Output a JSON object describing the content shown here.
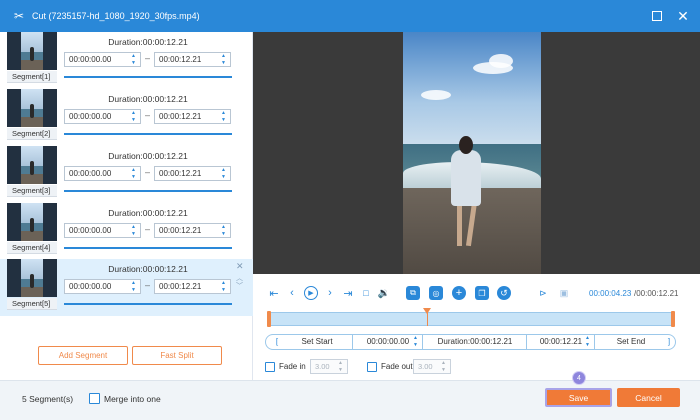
{
  "window": {
    "title": "Cut (7235157-hd_1080_1920_30fps.mp4)",
    "icons": {
      "app": "scissors-icon",
      "maximize": "maximize-icon",
      "close": "close-icon"
    }
  },
  "segments": [
    {
      "label": "Segment[1]",
      "duration": "Duration:00:00:12.21",
      "start": "00:00:00.00",
      "end": "00:00:12.21",
      "active": false
    },
    {
      "label": "Segment[2]",
      "duration": "Duration:00:00:12.21",
      "start": "00:00:00.00",
      "end": "00:00:12.21",
      "active": false
    },
    {
      "label": "Segment[3]",
      "duration": "Duration:00:00:12.21",
      "start": "00:00:00.00",
      "end": "00:00:12.21",
      "active": false
    },
    {
      "label": "Segment[4]",
      "duration": "Duration:00:00:12.21",
      "start": "00:00:00.00",
      "end": "00:00:12.21",
      "active": false
    },
    {
      "label": "Segment[5]",
      "duration": "Duration:00:00:12.21",
      "start": "00:00:00.00",
      "end": "00:00:12.21",
      "active": true
    }
  ],
  "left_actions": {
    "add_segment": "Add Segment",
    "fast_split": "Fast Split"
  },
  "player": {
    "current_time": "00:00:04.23",
    "total_time": "/00:00:12.21",
    "playhead_fraction": 0.39,
    "icons": [
      "jump-start-icon",
      "prev-frame-icon",
      "play-icon",
      "next-frame-icon",
      "jump-end-icon",
      "stop-icon",
      "volume-icon",
      "copy-segment-icon",
      "snapshot-icon",
      "add-icon",
      "duplicate-icon",
      "reset-icon",
      "fit-icon",
      "fullscreen-icon"
    ]
  },
  "edit": {
    "set_start": "Set Start",
    "start_value": "00:00:00.00",
    "duration": "Duration:00:00:12.21",
    "end_value": "00:00:12.21",
    "set_end": "Set End"
  },
  "fade": {
    "fade_in_label": "Fade in",
    "fade_in_value": "3.00",
    "fade_out_label": "Fade out",
    "fade_out_value": "3.00"
  },
  "footer": {
    "segment_count": "5 Segment(s)",
    "merge_label": "Merge into one",
    "save": "Save",
    "cancel": "Cancel",
    "step_badge": "4"
  },
  "colors": {
    "accent": "#2a88d8",
    "action": "#f07a37",
    "highlight": "#dff0fd"
  }
}
